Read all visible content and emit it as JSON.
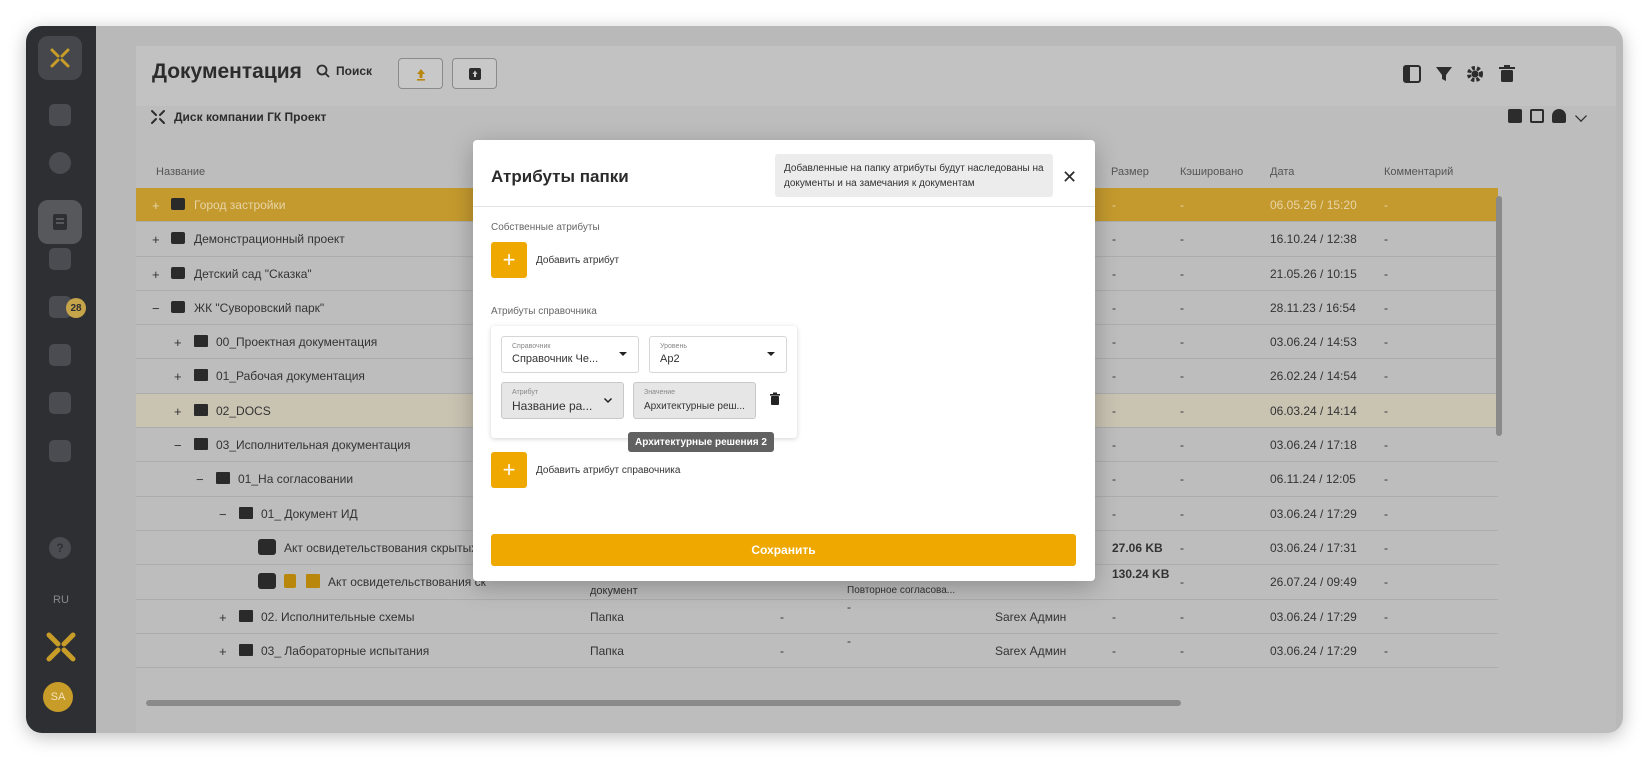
{
  "sidebar": {
    "badge_count": "28",
    "help_label": "?",
    "language": "RU",
    "avatar_initials": "SA"
  },
  "header": {
    "title": "Документация",
    "search_label": "Поиск"
  },
  "disk": {
    "name": "Диск компании ГК Проект"
  },
  "columns": {
    "name": "Название",
    "size": "Размер",
    "cached": "Кэшировано",
    "date": "Дата",
    "comment": "Комментарий"
  },
  "rows": [
    {
      "expander": "+",
      "name": "Город застройки",
      "size": "-",
      "cached": "-",
      "date": "06.05.26 / 15:20",
      "comment": "-"
    },
    {
      "expander": "+",
      "name": "Демонстрационный проект",
      "size": "-",
      "cached": "-",
      "date": "16.10.24 / 12:38",
      "comment": "-"
    },
    {
      "expander": "+",
      "name": "Детский сад \"Сказка\"",
      "size": "-",
      "cached": "-",
      "date": "21.05.26 / 10:15",
      "comment": "-"
    },
    {
      "expander": "−",
      "name": "ЖК \"Суворовский парк\"",
      "size": "-",
      "cached": "-",
      "date": "28.11.23 / 16:54",
      "comment": "-"
    },
    {
      "expander": "+",
      "name": "00_Проектная документация",
      "size": "-",
      "cached": "-",
      "date": "03.06.24 / 14:53",
      "comment": "-"
    },
    {
      "expander": "+",
      "name": "01_Рабочая документация",
      "size": "-",
      "cached": "-",
      "date": "26.02.24 / 14:54",
      "comment": "-"
    },
    {
      "expander": "+",
      "name": "02_DOCS",
      "size": "-",
      "cached": "-",
      "date": "06.03.24 / 14:14",
      "comment": "-"
    },
    {
      "expander": "−",
      "name": "03_Исполнительная документация",
      "size": "-",
      "cached": "-",
      "date": "03.06.24 / 17:18",
      "comment": "-"
    },
    {
      "expander": "−",
      "name": "01_На согласовании",
      "size": "-",
      "cached": "-",
      "date": "06.11.24 / 12:05",
      "comment": "-"
    },
    {
      "expander": "−",
      "name": "01_ Документ ИД",
      "size": "-",
      "cached": "-",
      "date": "03.06.24 / 17:29",
      "comment": "-"
    },
    {
      "expander": "",
      "name": "Акт освидетельствования скрытых ра",
      "size": "27.06 KB",
      "cached": "-",
      "date": "03.06.24 / 17:31",
      "comment": "-"
    },
    {
      "expander": "",
      "name": "Акт освидетельствования ск",
      "type": "документ",
      "status": "Повторное согласова...",
      "size": "130.24 KB",
      "cached": "-",
      "date": "26.07.24 / 09:49",
      "comment": "-"
    },
    {
      "expander": "+",
      "name": "02. Исполнительные схемы",
      "type": "Папка",
      "dash": "-",
      "author": "Sarex Админ",
      "size": "-",
      "cached": "-",
      "date": "03.06.24 / 17:29",
      "comment": "-"
    },
    {
      "expander": "+",
      "name": "03_ Лабораторные испытания",
      "type": "Папка",
      "dash": "-",
      "author": "Sarex Админ",
      "size": "-",
      "cached": "-",
      "date": "03.06.24 / 17:29",
      "comment": "-"
    }
  ],
  "modal": {
    "title": "Атрибуты папки",
    "note": "Добавленные на папку атрибуты будут наследованы на документы и на замечания к документам",
    "close": "✕",
    "own_label": "Собственные атрибуты",
    "add_attribute": "Добавить атрибут",
    "ref_label": "Атрибуты справочника",
    "add_ref_attribute": "Добавить атрибут справочника",
    "plus": "+",
    "fields": {
      "catalog": {
        "label": "Справочник",
        "value": "Справочник Че..."
      },
      "level": {
        "label": "Уровень",
        "value": "Ар2"
      },
      "attribute": {
        "label": "Атрибут",
        "value": "Название ра..."
      },
      "value": {
        "label": "Значение",
        "value": "Архитектурные реш..."
      }
    },
    "tooltip": "Архитектурные решения 2",
    "save": "Сохранить"
  },
  "colors": {
    "accent": "#efa800",
    "sidebar": "#2d2f33",
    "overlay": "#bdbdbd"
  }
}
